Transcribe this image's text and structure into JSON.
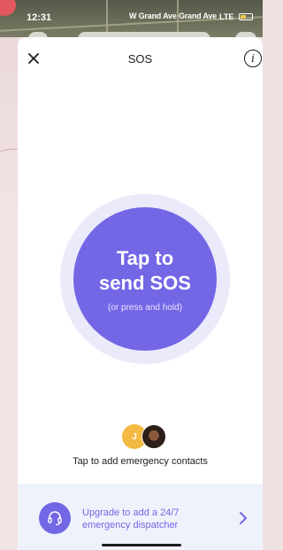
{
  "status_bar": {
    "time": "12:31",
    "street": "W Grand Ave   Grand Ave",
    "signal": "LTE"
  },
  "header": {
    "title": "SOS",
    "close_icon": "close-icon",
    "info_icon": "info-icon",
    "info_glyph": "i"
  },
  "sos": {
    "line1": "Tap to",
    "line2": "send SOS",
    "hint": "(or press and hold)"
  },
  "contacts": {
    "avatar_initial": "J",
    "add_label": "Tap to add emergency contacts"
  },
  "upgrade": {
    "line1": "Upgrade to add a 24/7",
    "line2": "emergency dispatcher",
    "icon": "headset-icon",
    "chevron": "chevron-right-icon"
  },
  "colors": {
    "accent": "#7367e6",
    "ring": "#ebeafb",
    "banner": "#eef3fb",
    "avatar": "#f4b942"
  }
}
